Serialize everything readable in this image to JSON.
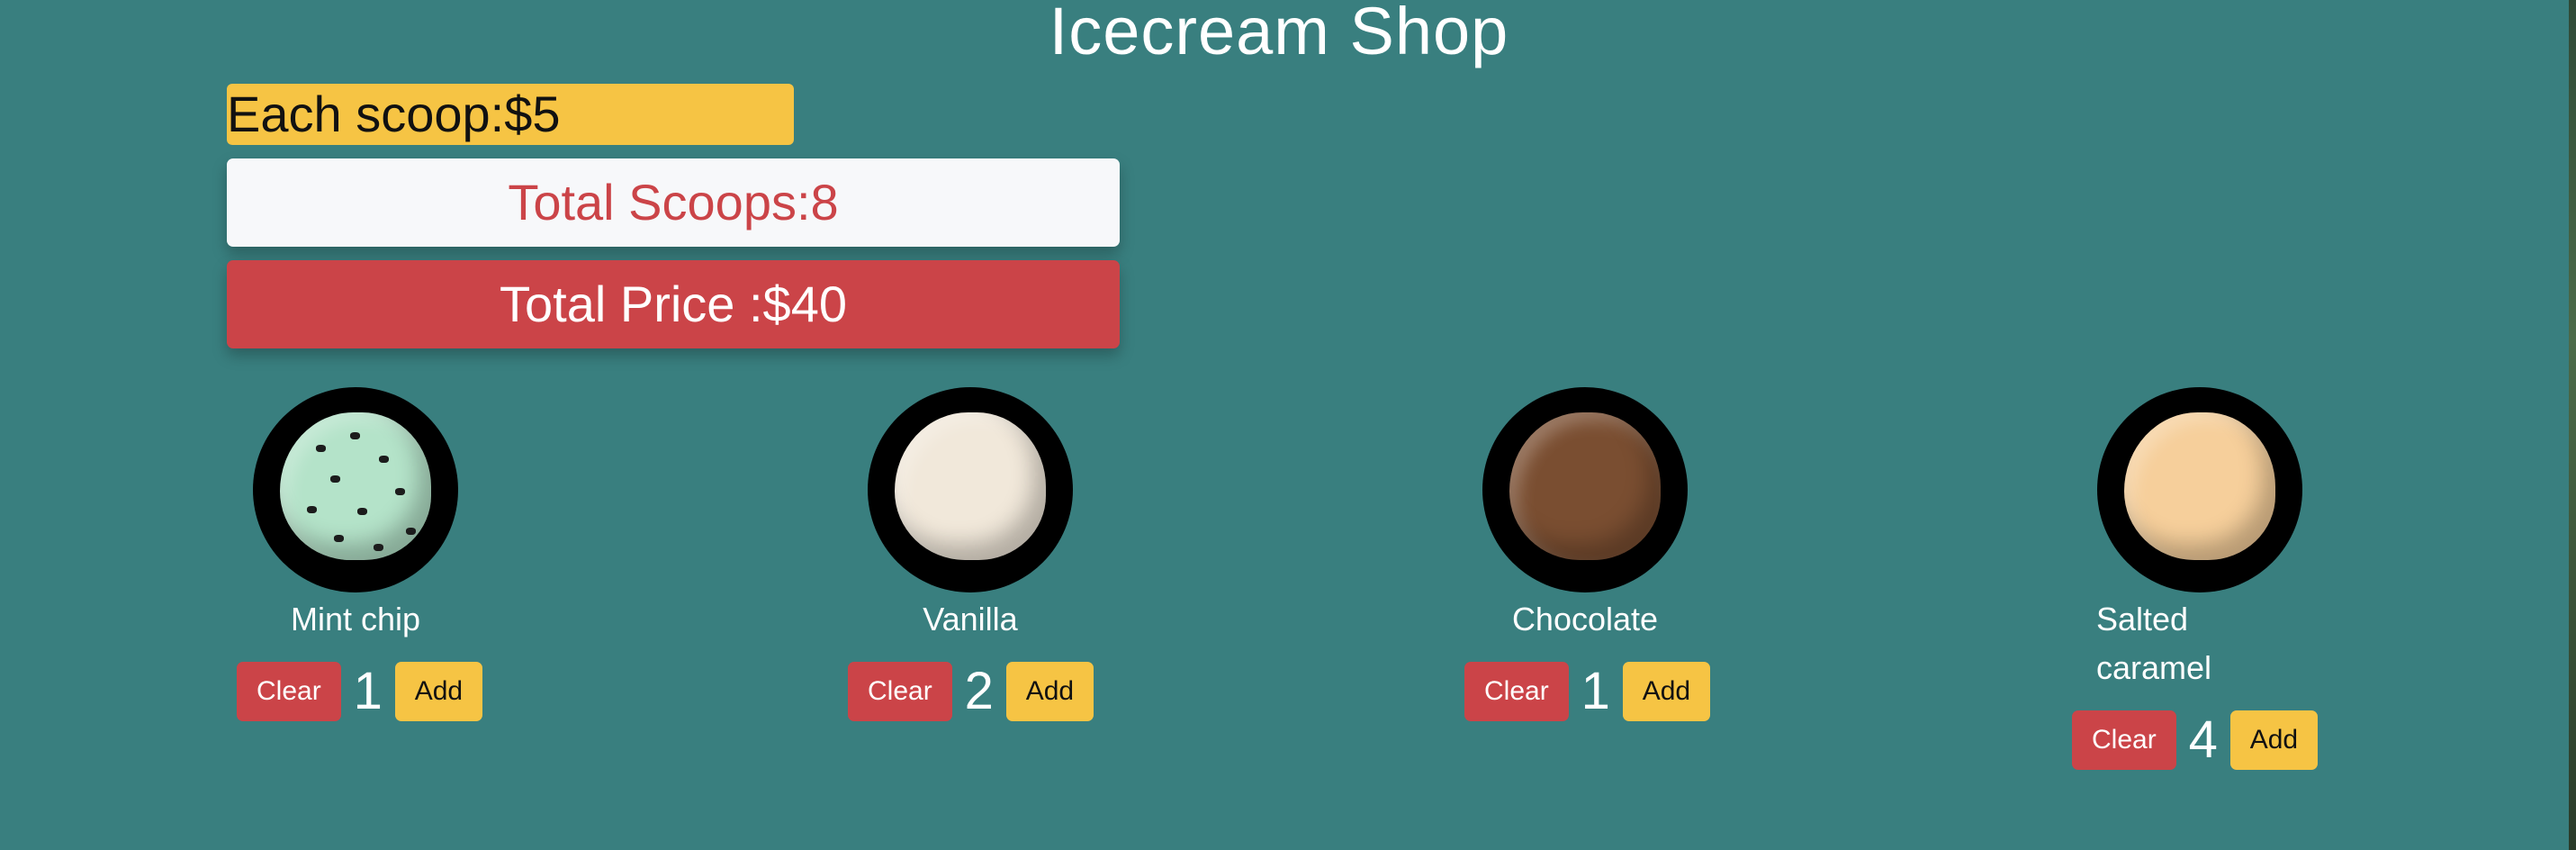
{
  "shop": {
    "title": "Icecream Shop",
    "scoop_price_label": "Each scoop:$5",
    "total_scoops_label": "Total Scoops:8",
    "total_price_label": "Total Price :$40"
  },
  "flavors": [
    {
      "name": "Mint chip",
      "quantity": "1",
      "clear_label": "Clear",
      "add_label": "Add",
      "image": "mint-chip-scoop"
    },
    {
      "name": "Vanilla",
      "quantity": "2",
      "clear_label": "Clear",
      "add_label": "Add",
      "image": "vanilla-scoop"
    },
    {
      "name": "Chocolate",
      "quantity": "1",
      "clear_label": "Clear",
      "add_label": "Add",
      "image": "chocolate-scoop"
    },
    {
      "name": "Salted caramel",
      "quantity": "4",
      "clear_label": "Clear",
      "add_label": "Add",
      "image": "salted-caramel-scoop"
    }
  ],
  "colors": {
    "background": "#397f7f",
    "accent_yellow": "#f6c444",
    "accent_red": "#cb4448",
    "card_light": "#f7f8fa"
  }
}
